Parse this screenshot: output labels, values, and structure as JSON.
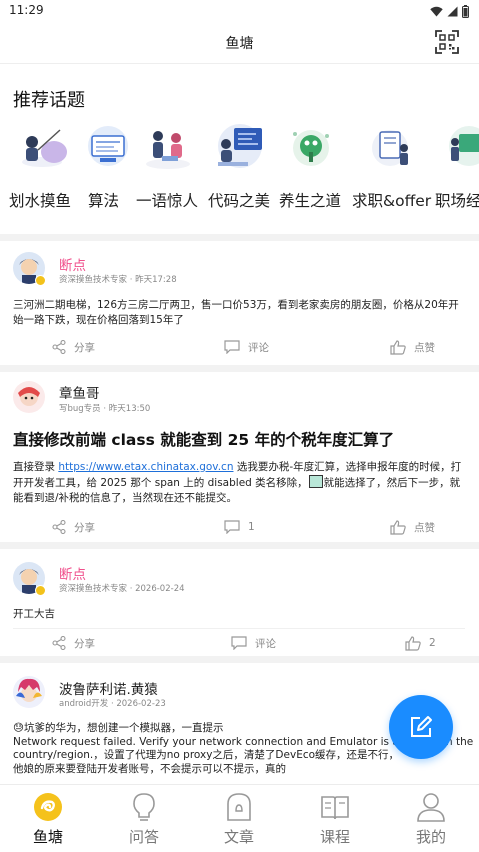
{
  "status_bar": {
    "time": "11:29",
    "icons": [
      "wifi-icon",
      "signal-icon",
      "battery-icon"
    ]
  },
  "header": {
    "title": "鱼塘",
    "qr_icon": "qr-scan-icon"
  },
  "topics": {
    "section_title": "推荐话题",
    "items": [
      {
        "label": "划水摸鱼",
        "icon": "fishing-illustration"
      },
      {
        "label": "算法",
        "icon": "algorithm-illustration"
      },
      {
        "label": "一语惊人",
        "icon": "speech-illustration"
      },
      {
        "label": "代码之美",
        "icon": "code-illustration"
      },
      {
        "label": "养生之道",
        "icon": "health-illustration"
      },
      {
        "label": "求职&offer",
        "icon": "job-illustration"
      },
      {
        "label": "职场经",
        "icon": "career-illustration"
      }
    ]
  },
  "posts": [
    {
      "author": "断点",
      "author_color": "#f0508c",
      "meta": "资深摸鱼技术专家 · 昨天17:28",
      "text": "三河洲二期电梯，126方三房二厅两卫，售一口价53万，看到老家卖房的朋友圈，价格从20年开始一路下跌，现在价格回落到15年了",
      "actions": {
        "share": "分享",
        "comment": "评论",
        "like": "点赞"
      }
    },
    {
      "author": "章鱼哥",
      "author_color": "#222222",
      "meta": "写bug专员 · 昨天13:50",
      "title": "直接修改前端 class 就能查到 25 年的个税年度汇算了",
      "text_before_link": "直接登录 ",
      "link": "https://www.etax.chinatax.gov.cn",
      "text_after_link": " 选我要办税-年度汇算，选择申报年度的时候，打开开发者工具，给 2025 那个 span 上的 disabled 类名移除，",
      "text_after_box": "就能选择了，然后下一步，就能看到退/补税的信息了，当然现在还不能提交。",
      "actions": {
        "share": "分享",
        "comment": "1",
        "like": "点赞"
      }
    },
    {
      "author": "断点",
      "author_color": "#f0508c",
      "meta": "资深摸鱼技术专家 · 2026-02-24",
      "text": "开工大吉",
      "actions": {
        "share": "分享",
        "comment": "评论",
        "like": "2"
      }
    },
    {
      "author": "波鲁萨利诺.黄猿",
      "author_color": "#222222",
      "meta": "android开发 · 2026-02-23",
      "text_lines": [
        "😓坑爹的华为，想创建一个模拟器，一直提示",
        "Network request failed. Verify your network connection and Emulator is available in the country/region.，设置了代理为no proxy之后，清楚了DevEco缓存，还是不行，",
        "他娘的原来要登陆开发者账号，不会提示可以不提示，真的"
      ]
    }
  ],
  "fab": {
    "icon": "edit-icon",
    "color": "#1a8cff"
  },
  "bottom_nav": {
    "items": [
      {
        "label": "鱼塘",
        "icon": "fishpond-icon",
        "active": true
      },
      {
        "label": "问答",
        "icon": "lightbulb-icon",
        "active": false
      },
      {
        "label": "文章",
        "icon": "article-icon",
        "active": false
      },
      {
        "label": "课程",
        "icon": "book-icon",
        "active": false
      },
      {
        "label": "我的",
        "icon": "profile-icon",
        "active": false
      }
    ]
  },
  "colors": {
    "accent": "#1a8cff",
    "author_pink": "#f0508c",
    "active_nav": "#f5c21b",
    "link": "#1e6fd9"
  }
}
